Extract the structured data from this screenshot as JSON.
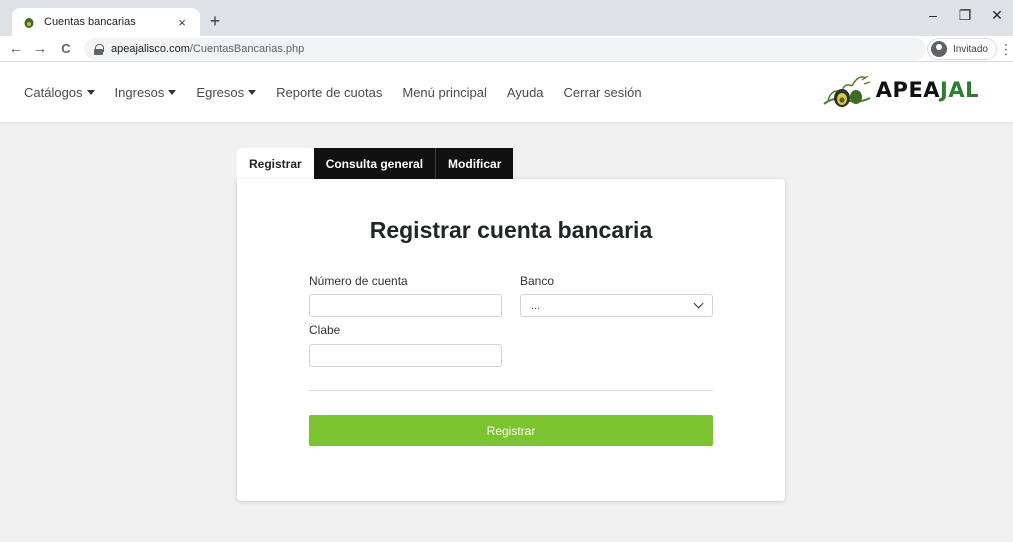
{
  "browser": {
    "tab_title": "Cuentas bancarias",
    "tab_close": "×",
    "new_tab": "+",
    "url_domain": "apeajalisco.com",
    "url_path": "/CuentasBancarias.php",
    "profile_label": "Invitado",
    "back": "←",
    "forward": "→",
    "reload": "C",
    "minimize": "–",
    "restore": "❐",
    "close": "✕",
    "menu": "⋮"
  },
  "navbar": {
    "items": [
      {
        "label": "Catálogos",
        "dropdown": true
      },
      {
        "label": "Ingresos",
        "dropdown": true
      },
      {
        "label": "Egresos",
        "dropdown": true
      },
      {
        "label": "Reporte de cuotas",
        "dropdown": false
      },
      {
        "label": "Menú principal",
        "dropdown": false
      },
      {
        "label": "Ayuda",
        "dropdown": false
      },
      {
        "label": "Cerrar sesión",
        "dropdown": false
      }
    ],
    "brand_prefix": "APEA",
    "brand_suffix": "JAL"
  },
  "form_tabs": [
    {
      "label": "Registrar",
      "active": true
    },
    {
      "label": "Consulta general",
      "active": false
    },
    {
      "label": "Modificar",
      "active": false
    }
  ],
  "form": {
    "title": "Registrar cuenta bancaria",
    "account_label": "Número de cuenta",
    "account_value": "",
    "bank_label": "Banco",
    "bank_selected": "...",
    "clabe_label": "Clabe",
    "clabe_value": "",
    "submit_label": "Registrar"
  },
  "colors": {
    "submit": "#7cc42f",
    "tab_dark": "#111111",
    "page_bg": "#f0f0f0",
    "brand_accent": "#2e7d32"
  },
  "icons": {
    "favicon": "avocado-icon",
    "lock": "lock-icon",
    "profile": "profile-icon",
    "brand": "avocado-logo"
  }
}
